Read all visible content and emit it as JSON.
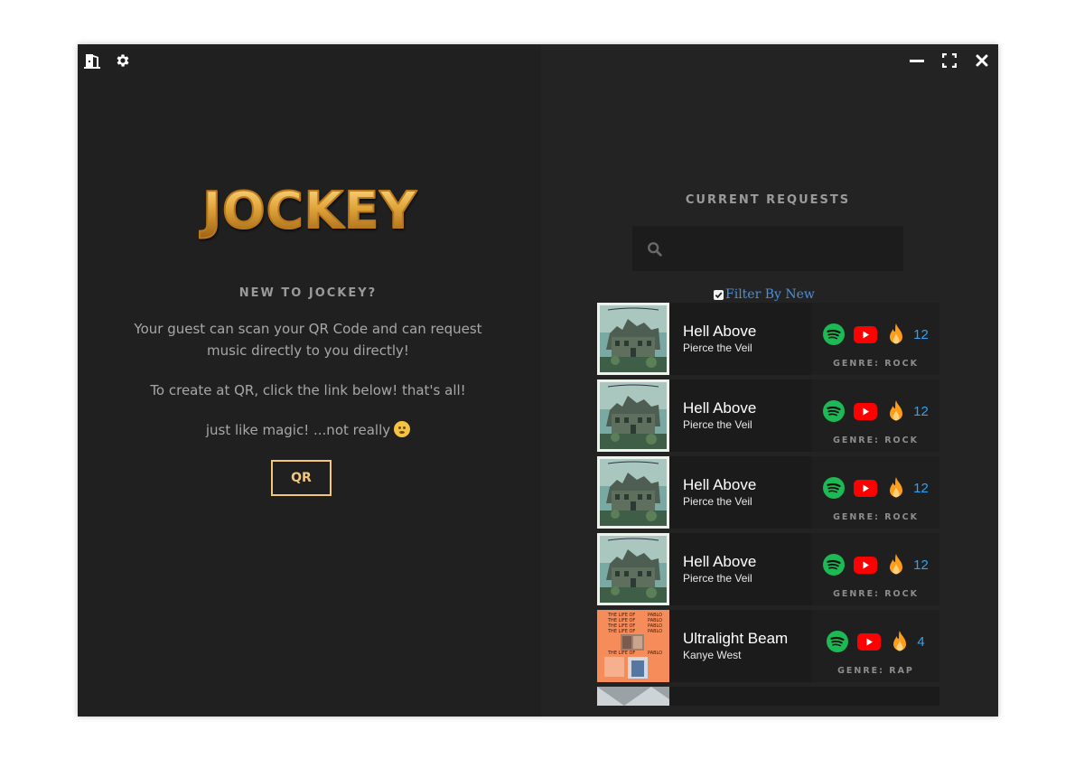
{
  "logo": {
    "text": "JOCKEY"
  },
  "left": {
    "title": "NEW TO JOCKEY?",
    "para1": "Your guest can scan your QR Code and can request music directly to you directly!",
    "para2": "To create at QR, click the link below! that's all!",
    "para3": "just like magic! ...not really",
    "qr_label": "QR"
  },
  "right": {
    "title": "CURRENT REQUESTS",
    "search": {
      "placeholder": "",
      "value": ""
    },
    "filter_label": "Filter By New",
    "filter_checked": true
  },
  "requests": [
    {
      "title": "Hell Above",
      "artist": "Pierce the Veil",
      "count": "12",
      "genre": "GENRE: ROCK",
      "cover": "collide-with-the-sky"
    },
    {
      "title": "Hell Above",
      "artist": "Pierce the Veil",
      "count": "12",
      "genre": "GENRE: ROCK",
      "cover": "collide-with-the-sky"
    },
    {
      "title": "Hell Above",
      "artist": "Pierce the Veil",
      "count": "12",
      "genre": "GENRE: ROCK",
      "cover": "collide-with-the-sky"
    },
    {
      "title": "Hell Above",
      "artist": "Pierce the Veil",
      "count": "12",
      "genre": "GENRE: ROCK",
      "cover": "collide-with-the-sky"
    },
    {
      "title": "Ultralight Beam",
      "artist": "Kanye West",
      "count": "4",
      "genre": "GENRE: RAP",
      "cover": "life-of-pablo"
    }
  ],
  "cover_art_text": {
    "pablo": [
      "THE LIFE OF",
      "PABLO"
    ]
  },
  "colors": {
    "background": "#202020",
    "accent": "#f2c77a",
    "count": "#2fa3f2",
    "spotify": "#1db954",
    "youtube": "#ff0000",
    "flame": "#ff9c1a",
    "filter_link": "#4a90d9"
  },
  "icons": {
    "window_left": [
      "exit-door-icon",
      "gear-icon"
    ],
    "window_right": [
      "minimize-icon",
      "maximize-icon",
      "close-icon"
    ],
    "row": [
      "spotify-icon",
      "youtube-icon",
      "flame-icon"
    ]
  }
}
